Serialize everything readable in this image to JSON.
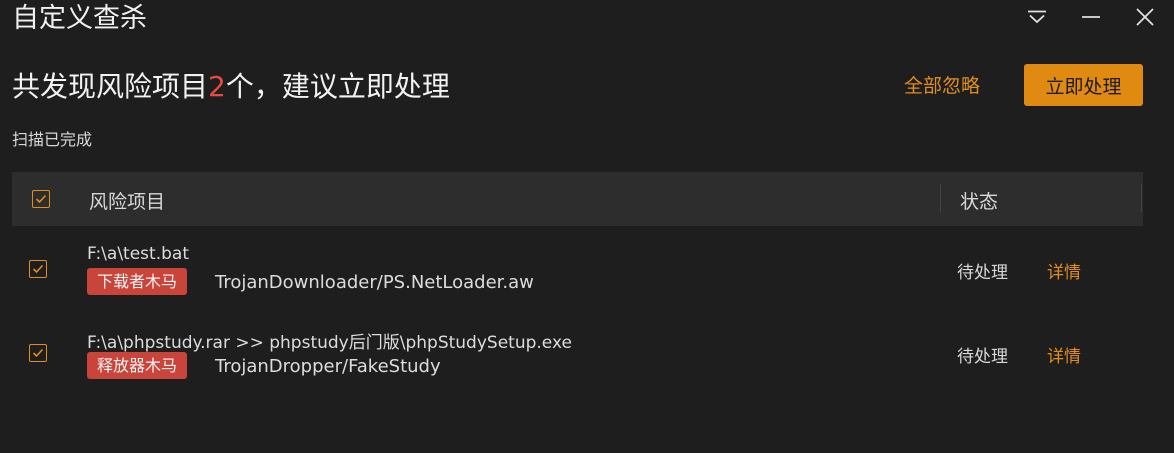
{
  "window": {
    "title": "自定义查杀",
    "controls": [
      "menu-icon",
      "minimize-icon",
      "close-icon"
    ]
  },
  "summary": {
    "headline_prefix": "共发现风险项目",
    "risk_count": "2",
    "headline_suffix": "个，建议立即处理",
    "scan_status": "扫描已完成"
  },
  "actions": {
    "ignore_all": "全部忽略",
    "handle_now": "立即处理"
  },
  "table": {
    "columns": {
      "risk_item": "风险项目",
      "status": "状态"
    },
    "rows": [
      {
        "checked": true,
        "path": "F:\\a\\test.bat",
        "tag": "下载者木马",
        "threat_name": "TrojanDownloader/PS.NetLoader.aw",
        "status": "待处理",
        "details": "详情"
      },
      {
        "checked": true,
        "path": "F:\\a\\phpstudy.rar >> phpstudy后门版\\phpStudySetup.exe",
        "tag": "释放器木马",
        "threat_name": "TrojanDropper/FakeStudy",
        "status": "待处理",
        "details": "详情"
      }
    ]
  },
  "colors": {
    "background": "#1e1e1e",
    "accent_orange": "#e08f1e",
    "button_orange": "#e08a12",
    "danger_red": "#e74c3c",
    "tag_red": "#c9453b",
    "header_bg": "#2d2d2d"
  }
}
